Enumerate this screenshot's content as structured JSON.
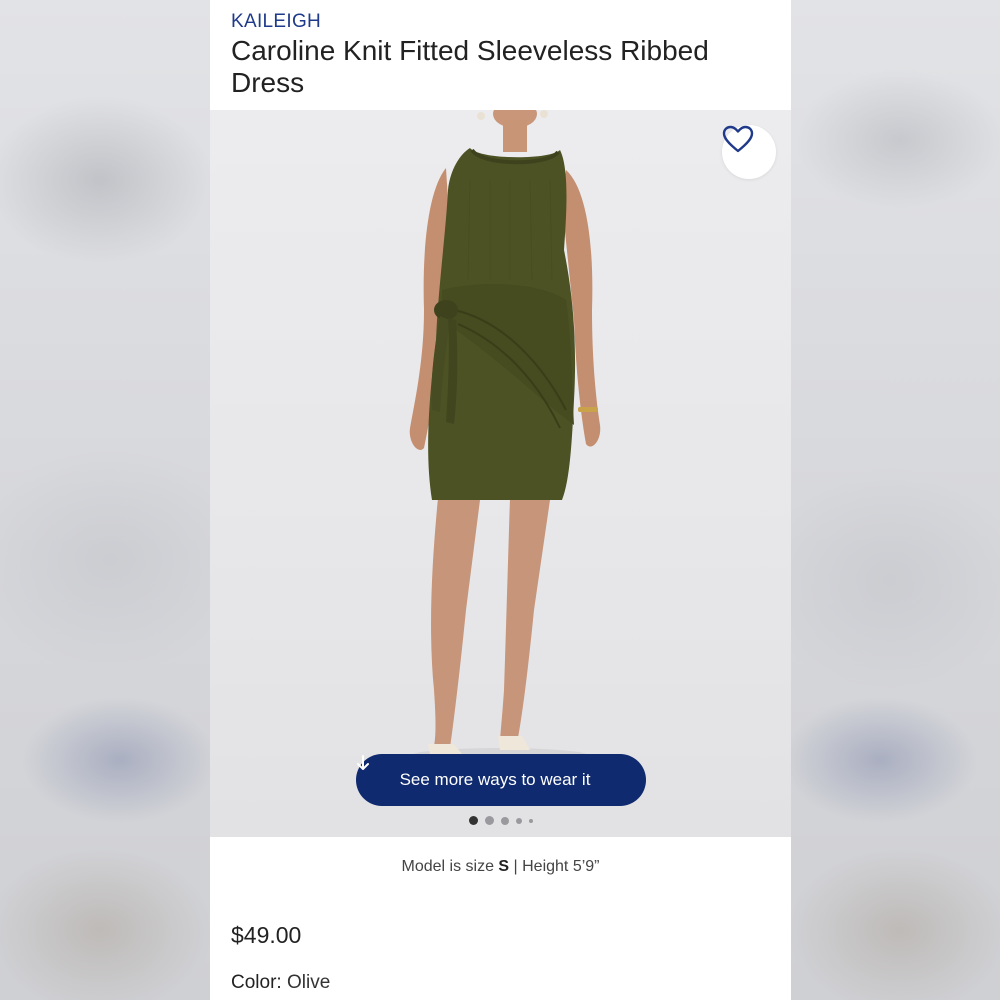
{
  "product": {
    "brand": "KAILEIGH",
    "title": "Caroline Knit Fitted Sleeveless Ribbed Dress"
  },
  "gallery": {
    "favorite_icon": "heart-outline-icon",
    "wear_button_label": "See more ways to wear it",
    "wear_button_icon": "arrow-down-icon",
    "image_count": 5,
    "active_index": 0
  },
  "model_info": {
    "prefix": "Model is size ",
    "size": "S",
    "separator": " | Height ",
    "height": "5’9”"
  },
  "price": "$49.00",
  "color": {
    "label": "Color:",
    "value": "Olive"
  },
  "colors": {
    "brand": "#1f3a8a",
    "button_bg": "#0f2a6e",
    "dress": "#4d5225"
  }
}
